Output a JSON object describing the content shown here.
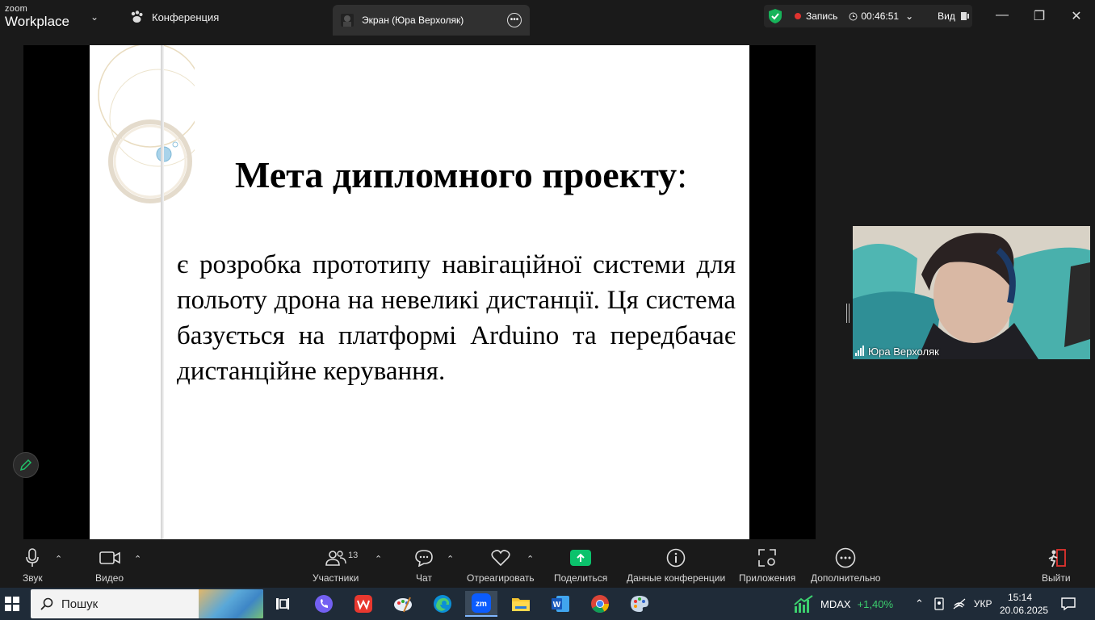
{
  "app": {
    "brand_top": "zoom",
    "brand_bottom": "Workplace"
  },
  "tabs": {
    "conference": "Конференция",
    "screen": "Экран (Юра Верхоляк)"
  },
  "status": {
    "recording_label": "Запись",
    "timer": "00:46:51",
    "view_label": "Вид"
  },
  "slide": {
    "title_main": "Мета дипломного проекту",
    "title_colon": ":",
    "body": "є розробка прототипу навігаційної системи для польоту дрона на невеликі дистанції. Ця система базується на платформі Arduino та передбачає дистанційне керування."
  },
  "participant": {
    "name": "Юра Верхоляк"
  },
  "toolbar": {
    "audio": "Звук",
    "video": "Видео",
    "participants": "Участники",
    "participants_count": "13",
    "chat": "Чат",
    "react": "Отреагировать",
    "share": "Поделиться",
    "meeting_info": "Данные конференции",
    "apps": "Приложения",
    "more": "Дополнительно",
    "leave": "Выйти"
  },
  "taskbar": {
    "search_placeholder": "Пошук",
    "stock_name": "MDAX",
    "stock_change": "+1,40%",
    "language": "УКР",
    "time": "15:14",
    "date": "20.06.2025"
  },
  "colors": {
    "accent_green": "#0bc26c",
    "record_red": "#e0332f",
    "stock_green": "#3ccf6e"
  }
}
